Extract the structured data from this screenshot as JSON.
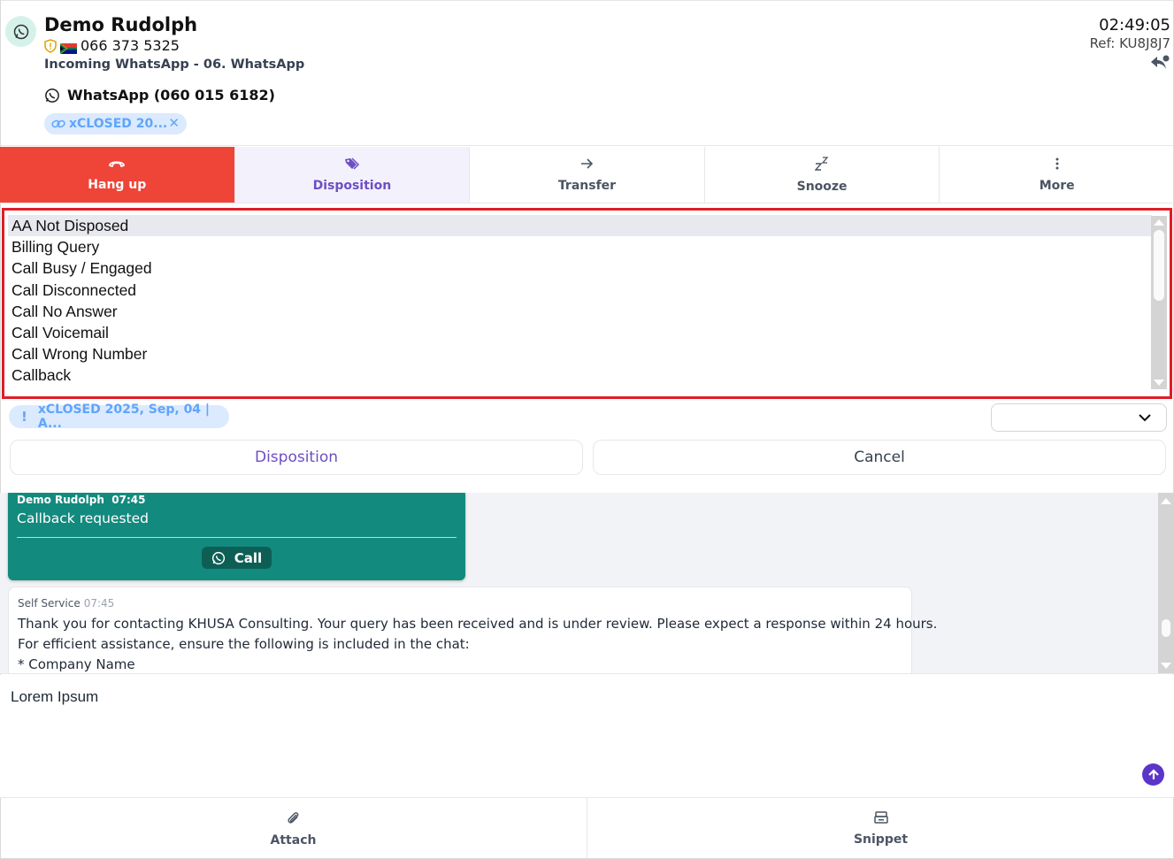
{
  "header": {
    "contact_name": "Demo Rudolph",
    "phone": "066 373 5325",
    "incoming": "Incoming WhatsApp - 06. WhatsApp",
    "channel": "WhatsApp (060 015 6182)",
    "tag": "xCLOSED 20...",
    "time": "02:49:05",
    "ref": "Ref: KU8J8J7"
  },
  "toolbar": {
    "hangup": "Hang up",
    "disposition": "Disposition",
    "transfer": "Transfer",
    "snooze": "Snooze",
    "more": "More"
  },
  "disposition_list": {
    "options": [
      "AA Not Disposed",
      "Billing Query",
      "Call Busy / Engaged",
      "Call Disconnected",
      "Call No Answer",
      "Call Voicemail",
      "Call Wrong Number",
      "Callback"
    ],
    "selected": "AA Not Disposed"
  },
  "disposition_chip": {
    "bang": "!",
    "text": "xCLOSED 2025, Sep, 04 | A..."
  },
  "actions": {
    "disposition": "Disposition",
    "cancel": "Cancel"
  },
  "chat": {
    "msg1": {
      "sender": "Demo Rudolph",
      "time": "07:45",
      "text": "Callback requested",
      "call_label": "Call"
    },
    "msg2": {
      "sender": "Self Service",
      "time": "07:45",
      "line1": "Thank you for contacting KHUSA Consulting. Your query has been received and is under review. Please expect a response within 24 hours.",
      "line2": "For efficient assistance, ensure the following is included in the chat:",
      "line3": "* Company Name"
    }
  },
  "composer": {
    "text": "Lorem Ipsum"
  },
  "footer": {
    "attach": "Attach",
    "snippet": "Snippet"
  },
  "colors": {
    "hangup_red": "#ef4438",
    "accent_purple": "#6d4fc4",
    "whatsapp_green": "#138a7e",
    "highlight_border": "#e01e27"
  }
}
